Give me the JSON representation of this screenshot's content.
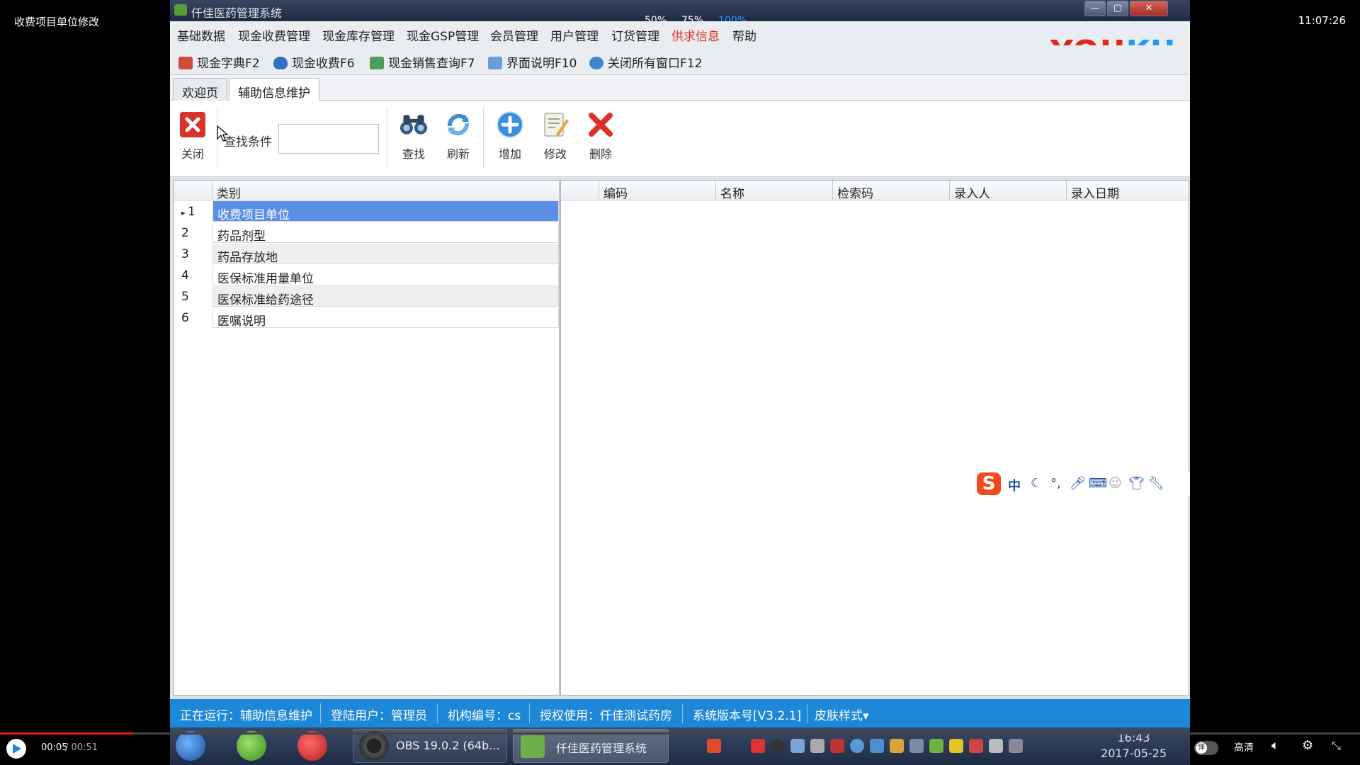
{
  "player": {
    "video_title": "收费项目单位修改",
    "clock": "11:07:26",
    "zoom_options": [
      "50%",
      "75%",
      "100%"
    ],
    "zoom_selected": "100%",
    "time_current": "00:05",
    "time_total": " / 00:51",
    "progress": 0.098,
    "quality_label": "高清",
    "toggle_label": "弹"
  },
  "app": {
    "title": "仟佳医药管理系统",
    "window_buttons": [
      "—",
      "▢",
      "✕"
    ],
    "menu": [
      "基础数据",
      "现金收费管理",
      "现金库存管理",
      "现金GSP管理",
      "会员管理",
      "用户管理",
      "订货管理",
      "供求信息",
      "帮助"
    ],
    "menu_highlight": "供求信息",
    "watermark": "YOUKU",
    "quick_buttons": [
      "现金字典F2",
      "现金收费F6",
      "现金销售查询F7",
      "界面说明F10",
      "关闭所有窗口F12"
    ],
    "tabs": [
      "欢迎页",
      "辅助信息维护"
    ],
    "active_tab": "辅助信息维护",
    "toolbar": {
      "close": "关闭",
      "search_label": "查找条件",
      "search_value": "",
      "find": "查找",
      "refresh": "刷新",
      "add": "增加",
      "edit": "修改",
      "delete": "删除"
    },
    "left_grid": {
      "column": "类别",
      "rows": [
        {
          "num": "1",
          "label": "收费项目单位"
        },
        {
          "num": "2",
          "label": "药品剂型"
        },
        {
          "num": "3",
          "label": "药品存放地"
        },
        {
          "num": "4",
          "label": "医保标准用量单位"
        },
        {
          "num": "5",
          "label": "医保标准给药途径"
        },
        {
          "num": "6",
          "label": "医嘱说明"
        }
      ],
      "selected_row": "1"
    },
    "right_grid": {
      "columns": [
        "编码",
        "名称",
        "检索码",
        "录入人",
        "录入日期"
      ]
    },
    "ime": {
      "logo": "S",
      "mode": "中"
    },
    "status": {
      "running": "正在运行：辅助信息维护",
      "user": "登陆用户：管理员",
      "org": "机构编号：cs",
      "license": "授权使用：仟佳测试药房",
      "version": "系统版本号[V3.2.1]",
      "skin": "皮肤样式▾"
    },
    "taskbar": {
      "obs": "OBS 19.0.2 (64b...",
      "app": "仟佳医药管理系统",
      "time": "16:43",
      "date": "2017-05-25"
    }
  },
  "colors": {
    "selected_row": "#5b8ee6",
    "status_bar": "#1e88d8",
    "menu_highlight": "#e0301e",
    "zoom_selected": "#2e9cff",
    "progress": "#e02020"
  }
}
